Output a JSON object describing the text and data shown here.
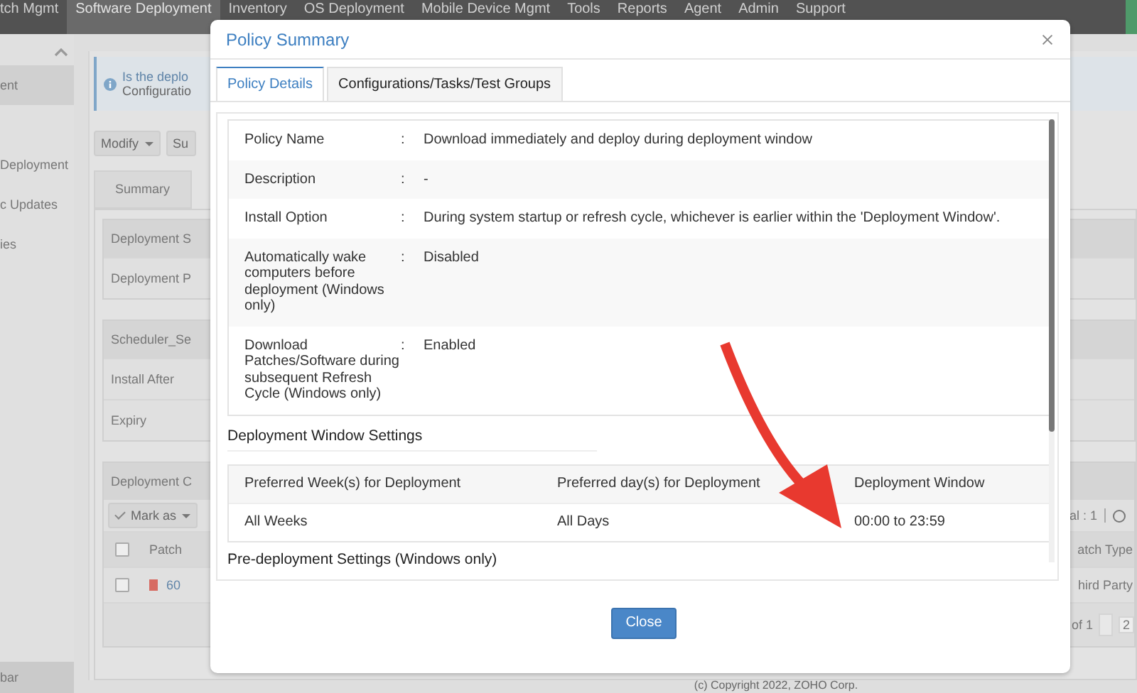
{
  "nav": {
    "items": [
      {
        "label": "tch Mgmt",
        "selected": false
      },
      {
        "label": "Software Deployment",
        "selected": true
      },
      {
        "label": "Inventory",
        "selected": false
      },
      {
        "label": "OS Deployment",
        "selected": false
      },
      {
        "label": "Mobile Device Mgmt",
        "selected": false
      },
      {
        "label": "Tools",
        "selected": false
      },
      {
        "label": "Reports",
        "selected": false
      },
      {
        "label": "Agent",
        "selected": false
      },
      {
        "label": "Admin",
        "selected": false
      },
      {
        "label": "Support",
        "selected": false
      }
    ]
  },
  "sidebar": {
    "items": [
      {
        "label": "ent",
        "selected": true
      },
      {
        "label": "Deployment",
        "selected": false
      },
      {
        "label": "c Updates",
        "selected": false
      },
      {
        "label": "ies",
        "selected": false
      }
    ],
    "footer": "bar"
  },
  "main": {
    "info": {
      "title": "Is the deplo",
      "text": "Configuratio"
    },
    "toolbar": [
      "Modify",
      "Su"
    ],
    "tab": "Summary",
    "cards": [
      {
        "title": "Deployment S",
        "rows": [
          "Deployment P"
        ]
      },
      {
        "title": "Scheduler_Se",
        "rows": [
          "Install After",
          "Expiry"
        ]
      }
    ],
    "patch_card": {
      "title": "Deployment C",
      "mark_button": "Mark as",
      "count": "al : 1",
      "select_all": {
        "checked": false
      },
      "columns": [
        "Patch",
        "atch Type"
      ],
      "row": {
        "checked": false,
        "patch": "60",
        "type": "hird Party"
      },
      "pager": {
        "text": "of 1",
        "page": "2"
      }
    },
    "copyright": "(c) Copyright 2022, ZOHO Corp."
  },
  "modal": {
    "title": "Policy Summary",
    "tabs": [
      {
        "label": "Policy Details",
        "selected": true
      },
      {
        "label": "Configurations/Tasks/Test Groups",
        "selected": false
      }
    ],
    "details": [
      {
        "label": "Policy Name",
        "separator": ":",
        "value": "Download immediately and deploy during deployment window"
      },
      {
        "label": "Description",
        "separator": ":",
        "value": "-"
      },
      {
        "label": "Install Option",
        "separator": ":",
        "value": "During system startup or refresh cycle, whichever is earlier within the 'Deployment Window'."
      },
      {
        "label": "Automatically wake computers before deployment (Windows only)",
        "separator": ":",
        "value": "Disabled"
      },
      {
        "label": "Download Patches/Software during subsequent Refresh Cycle (Windows only)",
        "separator": ":",
        "value": "Enabled"
      }
    ],
    "window_settings": {
      "title": "Deployment Window Settings",
      "columns": [
        "Preferred Week(s) for Deployment",
        "Preferred day(s) for Deployment",
        "Deployment Window"
      ],
      "rows": [
        [
          "All Weeks",
          "All Days",
          "00:00 to 23:59"
        ]
      ]
    },
    "next_section": "Pre-deployment Settings (Windows only)",
    "close_button": "Close"
  }
}
